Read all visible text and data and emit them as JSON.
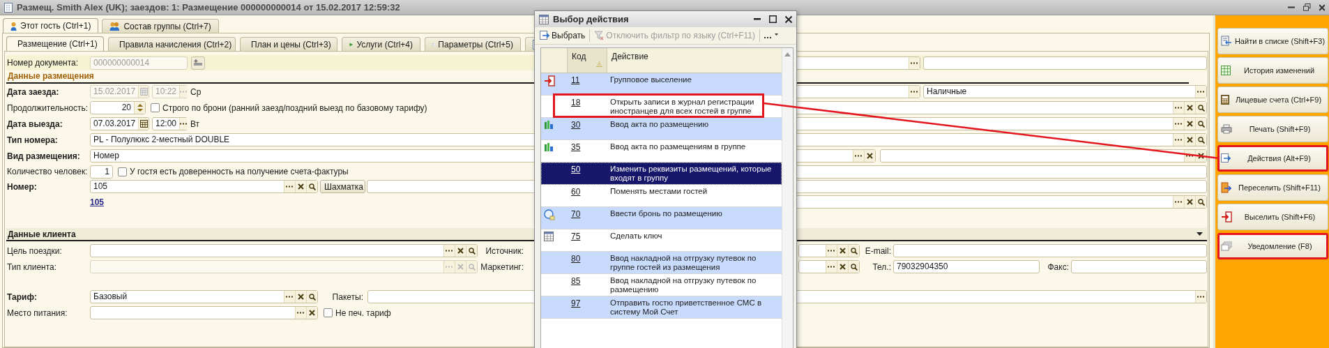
{
  "window": {
    "title": "Размещ. Smith Alex (UK); заездов: 1: Размещение 000000000014 от 15.02.2017 12:59:32"
  },
  "guest_tabs": [
    {
      "label": "Этот гость (Ctrl+1)",
      "selected": true
    },
    {
      "label": "Состав группы (Ctrl+7)",
      "selected": false
    }
  ],
  "tabs": [
    {
      "label": "Размещение (Ctrl+1)",
      "selected": true
    },
    {
      "label": "Правила начисления (Ctrl+2)",
      "selected": false
    },
    {
      "label": "План и цены (Ctrl+3)",
      "selected": false
    },
    {
      "label": "Услуги (Ctrl+4)",
      "selected": false
    },
    {
      "label": "Параметры (Ctrl+5)",
      "selected": false
    }
  ],
  "form": {
    "doc_number": {
      "label": "Номер документа:",
      "value": "000000000014",
      "disabled": true
    },
    "placement_section": "Данные размещения",
    "arrival": {
      "label": "Дата заезда:",
      "required": true,
      "date": "15.02.2017",
      "time": "10:22",
      "weekday": "Ср",
      "disabled": true
    },
    "payment": {
      "value": "Наличные"
    },
    "duration": {
      "label": "Продолжительность:",
      "required": false,
      "value": "20",
      "option": {
        "label": "Строго по брони (ранний заезд/поздний выезд по базовому тарифу)",
        "checked": false
      }
    },
    "departure": {
      "label": "Дата выезда:",
      "required": true,
      "date": "07.03.2017",
      "time": "12:00",
      "weekday": "Вт",
      "disabled": false
    },
    "room_type": {
      "label": "Тип номера:",
      "required": true,
      "value": "PL - Полулюкс 2-местный DOUBLE"
    },
    "placement_kind": {
      "label": "Вид размещения:",
      "required": true,
      "value": "Номер"
    },
    "guest_count": {
      "label": "Количество человек:",
      "required": false,
      "value": "1",
      "option": {
        "label": "У гостя есть доверенность на получение счета-фактуры",
        "checked": false
      }
    },
    "room": {
      "label": "Номер:",
      "required": true,
      "value": "105",
      "button": "Шахматка",
      "link": "105"
    },
    "client_section": "Данные клиента",
    "trip_purpose": {
      "label": "Цель поездки:",
      "required": false,
      "disabled": false
    },
    "source": {
      "label": "Источник:"
    },
    "email": {
      "label": "E-mail:"
    },
    "client_type": {
      "label": "Тип клиента:",
      "required": false,
      "disabled": true
    },
    "marketing": {
      "label": "Маркетинг:"
    },
    "phone": {
      "label": "Тел.:",
      "value": "79032904350"
    },
    "fax": {
      "label": "Факс:"
    },
    "tariff": {
      "label": "Тариф:",
      "required": true,
      "value": "Базовый"
    },
    "packages": {
      "label": "Пакеты:"
    },
    "meal": {
      "label": "Место питания:",
      "required": false
    },
    "no_print_tariff": {
      "label": "Не печ. тариф",
      "checked": false
    }
  },
  "dialog": {
    "title": "Выбор действия",
    "toolbar": {
      "select": "Выбрать",
      "filter": "Отключить фильтр по языку (Ctrl+F11)",
      "filter_disabled": true
    },
    "columns": [
      "Код",
      "Действие"
    ],
    "rows": [
      {
        "code": "11",
        "action": "Групповое выселение",
        "selected": false,
        "highlighted": false
      },
      {
        "code": "18",
        "action": "Открыть записи в журнал регистрации иностранцев для всех гостей в группе",
        "selected": false,
        "highlighted": true
      },
      {
        "code": "30",
        "action": "Ввод акта по размещению",
        "selected": false,
        "highlighted": false
      },
      {
        "code": "35",
        "action": "Ввод акта по размещениям в группе",
        "selected": false,
        "highlighted": false
      },
      {
        "code": "50",
        "action": "Изменить реквизиты размещений, которые входят в группу",
        "selected": true,
        "highlighted": false
      },
      {
        "code": "60",
        "action": "Поменять местами гостей",
        "selected": false,
        "highlighted": false
      },
      {
        "code": "70",
        "action": "Ввести бронь по размещению",
        "selected": false,
        "highlighted": false
      },
      {
        "code": "75",
        "action": "Сделать ключ",
        "selected": false,
        "highlighted": false
      },
      {
        "code": "80",
        "action": "Ввод накладной на отгрузку путевок по группе гостей из размещения",
        "selected": false,
        "highlighted": false
      },
      {
        "code": "85",
        "action": "Ввод накладной на отгрузку путевок по размещению",
        "selected": false,
        "highlighted": false
      },
      {
        "code": "97",
        "action": "Отправить гостю приветственное СМС в систему Мой Счет",
        "selected": false,
        "highlighted": false
      }
    ]
  },
  "side_buttons": [
    {
      "label": "Найти в списке (Shift+F3)",
      "highlighted": false
    },
    {
      "label": "История изменений",
      "highlighted": false
    },
    {
      "label": "Лицевые счета (Ctrl+F9)",
      "highlighted": false
    },
    {
      "label": "Печать (Shift+F9)",
      "highlighted": false
    },
    {
      "label": "Действия (Alt+F9)",
      "highlighted": true
    },
    {
      "label": "Переселить (Shift+F11)",
      "highlighted": false
    },
    {
      "label": "Выселить (Shift+F6)",
      "highlighted": false
    },
    {
      "label": "Уведомление (F8)",
      "highlighted": true
    }
  ]
}
